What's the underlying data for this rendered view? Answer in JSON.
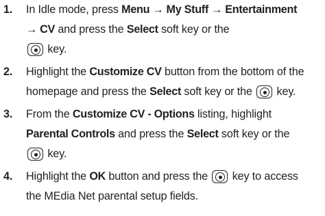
{
  "steps": [
    {
      "num": "1.",
      "t1": "In Idle mode, press ",
      "b1": "Menu → My Stuff → Entertainment",
      "b2": "→ CV",
      "t2": " and press the ",
      "b3": "Select",
      "t3": " soft key or the",
      "t4": " key."
    },
    {
      "num": "2.",
      "t1": "Highlight the ",
      "b1": "Customize CV",
      "t2": " button from the bottom of the",
      "t3": "homepage and press the ",
      "b2": "Select",
      "t4": " soft key or the ",
      "t5": " key."
    },
    {
      "num": "3.",
      "t1": "From the ",
      "b1": "Customize CV - Options",
      "t2": " listing, highlight",
      "b2": "Parental Controls",
      "t3": " and press the ",
      "b3": "Select",
      "t4": " soft key or the",
      "t5": " key."
    },
    {
      "num": "4.",
      "t1": "Highlight the ",
      "b1": "OK",
      "t2": " button and press the ",
      "t3": " key to access",
      "t4": "the MEdia Net parental setup fields."
    }
  ],
  "icons": {
    "ok_key": "ok-key-icon"
  },
  "colors": {
    "text": "#231f20",
    "background": "#ffffff"
  }
}
